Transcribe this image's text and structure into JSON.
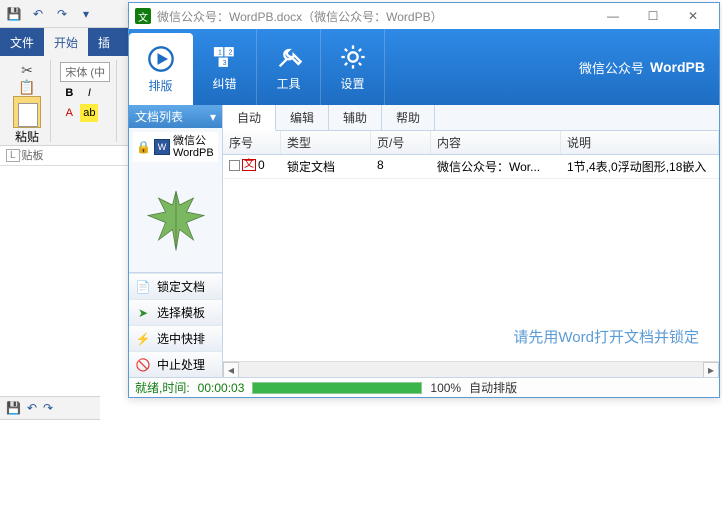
{
  "word": {
    "tabs": {
      "file": "文件",
      "home": "开始",
      "insert": "插"
    },
    "font_name": "宋体 (中",
    "group_clipboard": "剪贴板",
    "paste_label": "粘贴",
    "ruler_mark": "L"
  },
  "wpb": {
    "title": "微信公众号：WordPB.docx（微信公众号：WordPB）",
    "brand_prefix": "微信公众号",
    "brand_name": "WordPB",
    "ribbon": {
      "typeset": "排版",
      "correct": "纠错",
      "tools": "工具",
      "settings": "设置"
    },
    "side": {
      "header": "文档列表",
      "doc_name": "微信公\nWordPB",
      "btn_lock": "锁定文档",
      "btn_tpl": "选择模板",
      "btn_quick": "选中快排",
      "btn_stop": "中止处理"
    },
    "tabs": {
      "auto": "自动",
      "edit": "编辑",
      "assist": "辅助",
      "help": "帮助"
    },
    "columns": {
      "seq": "序号",
      "type": "类型",
      "page": "页/号",
      "content": "内容",
      "desc": "说明"
    },
    "row": {
      "seq_num": "0",
      "type": "锁定文档",
      "page": "8",
      "content": "微信公众号：Wor...",
      "desc": "1节,4表,0浮动图形,18嵌入"
    },
    "hint": "请先用Word打开文档并锁定",
    "status": {
      "label": "就绪,时间:",
      "time": "00:00:03",
      "percent": "100%",
      "mode": "自动排版"
    }
  }
}
